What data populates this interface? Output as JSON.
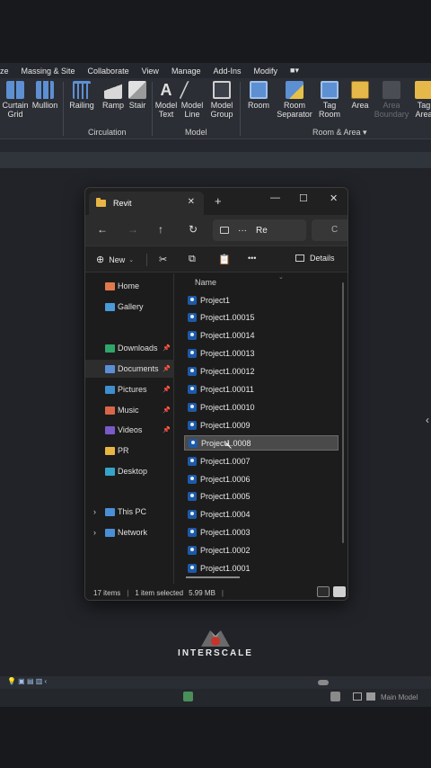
{
  "ribbon": {
    "tabs": [
      "ze",
      "Massing & Site",
      "Collaborate",
      "View",
      "Manage",
      "Add-Ins",
      "Modify"
    ],
    "items": [
      {
        "label": "Curtain\nGrid",
        "icon": "curtain-grid-icon"
      },
      {
        "label": "Mullion",
        "icon": "mullion-icon"
      },
      {
        "label": "Railing",
        "icon": "railing-icon"
      },
      {
        "label": "Ramp",
        "icon": "ramp-icon"
      },
      {
        "label": "Stair",
        "icon": "stair-icon"
      },
      {
        "label": "Model\nText",
        "icon": "model-text-icon"
      },
      {
        "label": "Model\nLine",
        "icon": "model-line-icon"
      },
      {
        "label": "Model\nGroup",
        "icon": "model-group-icon"
      },
      {
        "label": "Room",
        "icon": "room-icon"
      },
      {
        "label": "Room\nSeparator",
        "icon": "room-separator-icon"
      },
      {
        "label": "Tag\nRoom",
        "icon": "tag-room-icon"
      },
      {
        "label": "Area",
        "icon": "area-icon"
      },
      {
        "label": "Area\nBoundary",
        "icon": "area-boundary-icon"
      },
      {
        "label": "Tag\nArea",
        "icon": "tag-area-icon"
      }
    ],
    "groups": {
      "circulation": "Circulation",
      "model": "Model",
      "room_area": "Room & Area ▾"
    }
  },
  "explorer": {
    "tab_title": "Revit",
    "tab_close": "✕",
    "new_tab": "+",
    "window": {
      "minimize": "—",
      "maximize": "☐",
      "close": "✕"
    },
    "nav": {
      "back": "←",
      "forward": "→",
      "up": "↑",
      "refresh": "↻"
    },
    "address": {
      "more": "···",
      "text": "Re"
    },
    "search": {
      "text": "C"
    },
    "commands": {
      "new": "New",
      "more": "•••",
      "details": "Details"
    },
    "sidebar": [
      {
        "label": "Home",
        "icon": "home-icon",
        "pinned": false
      },
      {
        "label": "Gallery",
        "icon": "gallery-icon",
        "pinned": false
      },
      {
        "label": "Downloads",
        "icon": "downloads-icon",
        "pinned": true
      },
      {
        "label": "Documents",
        "icon": "documents-icon",
        "pinned": true,
        "selected": true
      },
      {
        "label": "Pictures",
        "icon": "pictures-icon",
        "pinned": true
      },
      {
        "label": "Music",
        "icon": "music-icon",
        "pinned": true
      },
      {
        "label": "Videos",
        "icon": "videos-icon",
        "pinned": true
      },
      {
        "label": "PR",
        "icon": "folder-icon",
        "pinned": false
      },
      {
        "label": "Desktop",
        "icon": "desktop-icon",
        "pinned": false
      },
      {
        "label": "This PC",
        "icon": "this-pc-icon",
        "pinned": false
      },
      {
        "label": "Network",
        "icon": "network-icon",
        "pinned": false
      }
    ],
    "column_header": "Name",
    "files": [
      "Project1",
      "Project1.00015",
      "Project1.00014",
      "Project1.00013",
      "Project1.00012",
      "Project1.00011",
      "Project1.00010",
      "Project1.0009",
      "Project1.0008",
      "Project1.0007",
      "Project1.0006",
      "Project1.0005",
      "Project1.0004",
      "Project1.0003",
      "Project1.0002",
      "Project1.0001"
    ],
    "selected_file": "Project1.0008",
    "status": {
      "items": "17 items",
      "selected": "1 item selected",
      "size": "5.99 MB"
    }
  },
  "logo": {
    "text": "INTERSCALE"
  },
  "statusbar_bottom": {
    "view_label": "Main Model"
  },
  "colors": {
    "accent": "#1d5aa8",
    "folder": "#e8b545",
    "selected_row": "#4a4a4a"
  }
}
